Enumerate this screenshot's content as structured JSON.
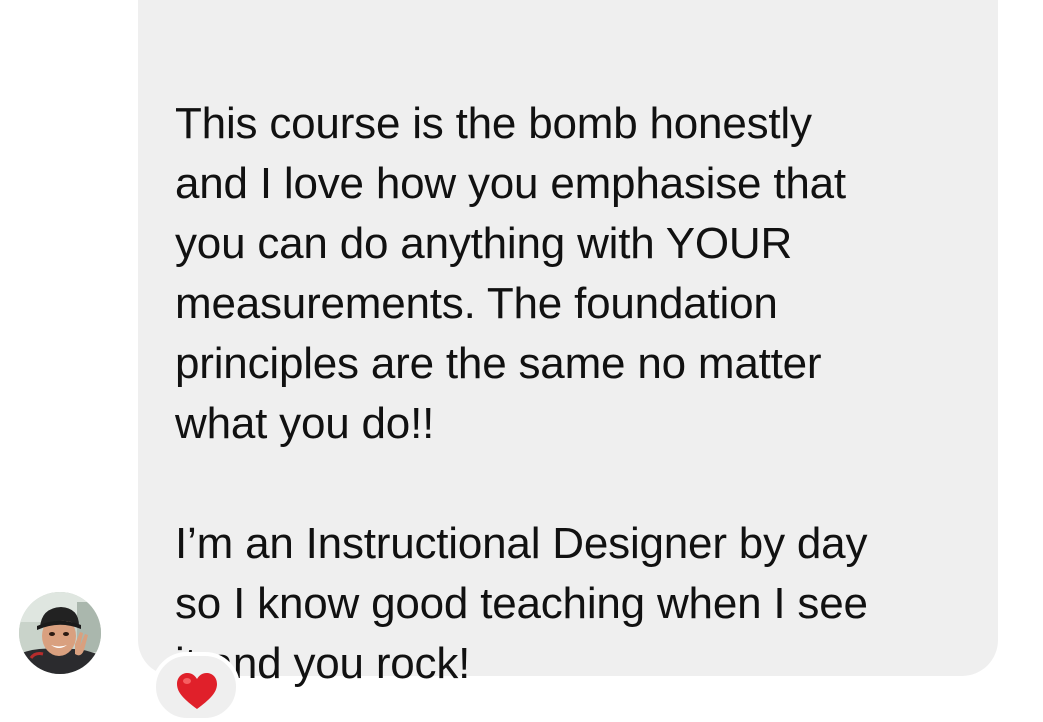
{
  "message": {
    "paragraphs": [
      "This course is the bomb honestly\nand I love how you emphasise that\nyou can do anything with YOUR\nmeasurements. The foundation\nprinciples are the same no matter\nwhat you do!!",
      "I’m an Instructional Designer by day\nso I know good teaching when I see\nit and you rock!"
    ],
    "bubble_color": "#efefef",
    "text_color": "#111111"
  },
  "sender": {
    "avatar_icon": "user-photo-avatar"
  },
  "reaction": {
    "icon": "red-heart-icon",
    "color": "#e0202a"
  }
}
